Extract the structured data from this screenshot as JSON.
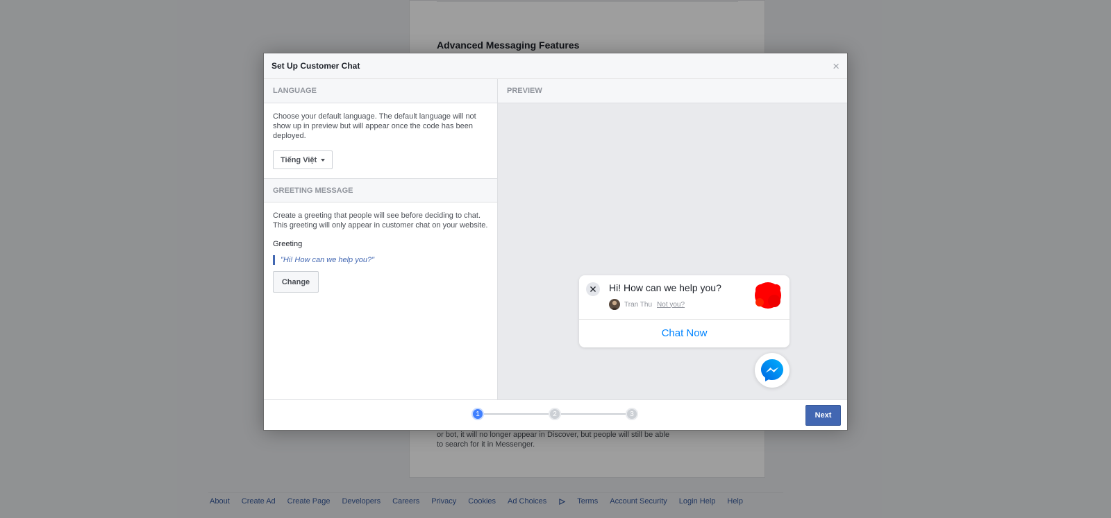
{
  "background": {
    "heading": "Advanced Messaging Features",
    "text": "or bot, it will no longer appear in Discover, but people will still be able to search for it in Messenger."
  },
  "footer": {
    "links": [
      "About",
      "Create Ad",
      "Create Page",
      "Developers",
      "Careers",
      "Privacy",
      "Cookies",
      "Ad Choices",
      "Terms",
      "Account Security",
      "Login Help",
      "Help"
    ]
  },
  "dialog": {
    "title": "Set Up Customer Chat",
    "close_label": "×",
    "language": {
      "header": "LANGUAGE",
      "description": "Choose your default language. The default language will not show up in preview but will appear once the code has been deployed.",
      "selected": "Tiếng Việt"
    },
    "greeting": {
      "header": "GREETING MESSAGE",
      "description": "Create a greeting that people will see before deciding to chat. This greeting will only appear in customer chat on your website.",
      "label": "Greeting",
      "quote": "\"Hi! How can we help you?\"",
      "change_label": "Change"
    },
    "preview": {
      "header": "PREVIEW",
      "message": "Hi! How can we help you?",
      "user_name": "Tran Thu",
      "not_you": "Not you?",
      "chat_now": "Chat Now"
    },
    "steps": [
      "1",
      "2",
      "3"
    ],
    "active_step": 1,
    "next_label": "Next"
  },
  "colors": {
    "accent": "#4267b2",
    "messenger_blue": "#0084ff",
    "step_active": "#4080ff"
  }
}
